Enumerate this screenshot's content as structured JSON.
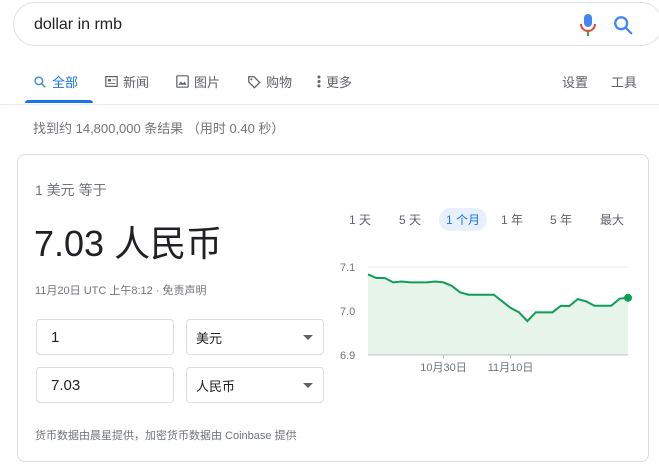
{
  "search": {
    "query": "dollar in rmb"
  },
  "tabs": [
    {
      "label": "全部"
    },
    {
      "label": "新闻"
    },
    {
      "label": "图片"
    },
    {
      "label": "购物"
    },
    {
      "label": "更多"
    },
    {
      "label": "设置"
    },
    {
      "label": "工具"
    }
  ],
  "stats": "找到约 14,800,000 条结果 （用时 0.40 秒）",
  "converter": {
    "from_line": "1 美元 等于",
    "result": "7.03 人民币",
    "meta": "11月20日 UTC 上午8:12 · 免责声明",
    "amount_from": "1",
    "unit_from": "美元",
    "amount_to": "7.03",
    "unit_to": "人民币",
    "credit": "货币数据由晨星提供，加密货币数据由 Coinbase 提供"
  },
  "ranges": [
    "1 天",
    "5 天",
    "1 个月",
    "1 年",
    "5 年",
    "最大"
  ],
  "active_range": "1 个月",
  "colors": {
    "accent": "#1a73e8",
    "chart_line": "#0f9d58",
    "chart_fill": "#e6f4ea"
  },
  "chart_data": {
    "type": "area",
    "title": "",
    "xlabel": "",
    "ylabel": "",
    "ylim": [
      6.9,
      7.1
    ],
    "yticks": [
      "7.1",
      "7.0",
      "6.9"
    ],
    "xticks": [
      {
        "label": "10月30日",
        "index": 9
      },
      {
        "label": "11月10日",
        "index": 17
      }
    ],
    "values": [
      7.083,
      7.075,
      7.075,
      7.065,
      7.067,
      7.065,
      7.065,
      7.065,
      7.067,
      7.065,
      7.057,
      7.042,
      7.037,
      7.037,
      7.037,
      7.037,
      7.022,
      7.007,
      6.997,
      6.977,
      6.997,
      6.997,
      6.997,
      7.012,
      7.011,
      7.027,
      7.022,
      7.012,
      7.012,
      7.012,
      7.028,
      7.03
    ],
    "grid": true
  }
}
